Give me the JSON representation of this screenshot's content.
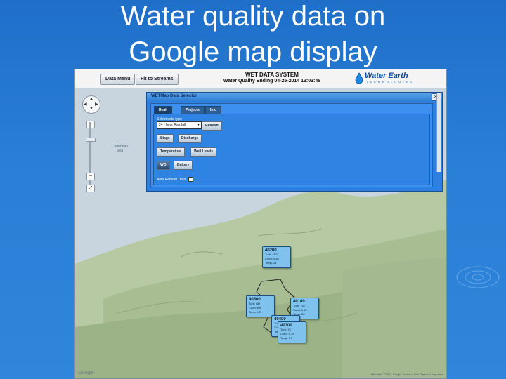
{
  "slide": {
    "title_line1": "Water quality data on",
    "title_line2": "Google map display"
  },
  "app": {
    "btn_data_menu": "Data Menu",
    "btn_fit": "Fit to Streams",
    "system_title": "WET DATA SYSTEM",
    "system_subtitle": "Water Quality Ending 04-25-2014 13:03:46",
    "logo_name": "Water Earth",
    "logo_sub": "TECHNOLOGIES"
  },
  "map": {
    "sea_label_line1": "Caribbean",
    "sea_label_line2": "Sea",
    "google": "Google",
    "attribution": "Map data ©2014 Google  Terms of Use  Report a map error",
    "zoom_in": "+",
    "zoom_out": "−"
  },
  "dialog": {
    "title": "WETMap Data Selector",
    "close": "×",
    "tabs": [
      "Real-time",
      "Projects",
      "Info"
    ],
    "select_label": "Select data type",
    "select_value": "24 - hour Rainfall",
    "refresh": "Refresh",
    "buttons": [
      "Stage",
      "Discharge",
      "Temperature",
      "Well Levels",
      "WQ",
      "Battery"
    ],
    "auto_refresh": "Auto Refresh Data"
  },
  "stations": [
    {
      "id": "40200",
      "lines": [
        "Turb: 1673",
        "Cond: 0.36",
        "Temp: 24"
      ]
    },
    {
      "id": "40500",
      "lines": [
        "Turb: NR",
        "Cond: NR",
        "Temp: NR"
      ]
    },
    {
      "id": "40100",
      "lines": [
        "Turb: 752",
        "Cond: 0.16",
        "Temp: 83"
      ]
    },
    {
      "id": "40400",
      "lines": [
        "Turb",
        "Cond",
        "Temp"
      ]
    },
    {
      "id": "40300",
      "lines": [
        "Turb: 75",
        "Cond: 0.16",
        "Temp: 67"
      ]
    }
  ]
}
